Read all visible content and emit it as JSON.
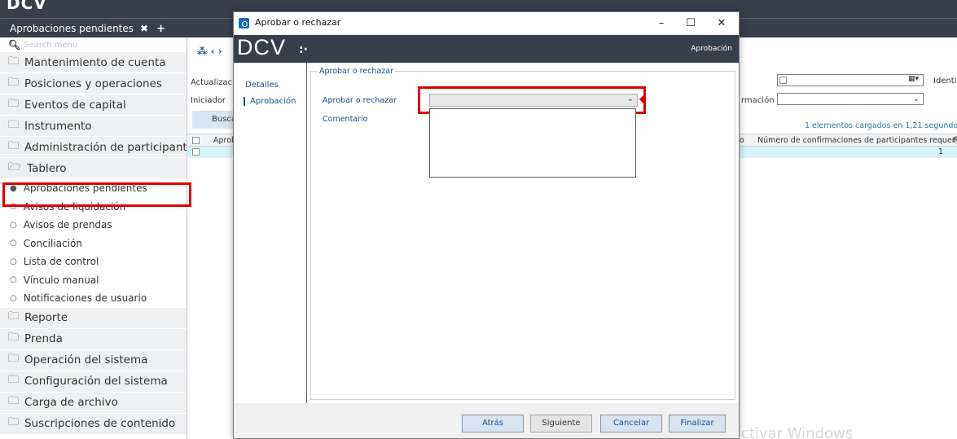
{
  "brand": {
    "logo_cut": "DCV"
  },
  "tabbar": {
    "active_tab": "Aprobaciones pendientes",
    "close_glyph": "✖",
    "add_glyph": "+"
  },
  "sidebar": {
    "search_placeholder": "Search menu",
    "groups_top": [
      "Mantenimiento de cuenta",
      "Posiciones y operaciones",
      "Eventos de capital",
      "Instrumento",
      "Administración de participantes",
      "Tablero"
    ],
    "tablero_items": [
      "Aprobaciones pendientes",
      "Avisos de liquidación",
      "Avisos de prendas",
      "Conciliación",
      "Lista de control",
      "Vínculo manual",
      "Notificaciones de usuario"
    ],
    "groups_bottom": [
      "Reporte",
      "Prenda",
      "Operación del sistema",
      "Configuración del sistema",
      "Carga de archivo",
      "Suscripciones de contenido"
    ]
  },
  "background": {
    "toolbar_glyphs": "⁂ ‹ ›",
    "label_actualizacion": "Actualizació",
    "label_iniciador": "Iniciador",
    "label_identif": "Identif",
    "label_rmacion": "rmación",
    "button_buscar": "Buscar",
    "loaded_text": "1 elementos cargados en 1,21 segundo",
    "col_aprob": "Aprob",
    "col_o": "o",
    "col_confirmaciones": "Número de confirmaciones de participantes requeridas",
    "col_f": "F",
    "row_value": "1",
    "watermark": "ctivar Windows"
  },
  "dialog": {
    "title": "Aprobar o rechazar",
    "window_buttons": {
      "minimize": "–",
      "maximize": "☐",
      "close": "✕"
    },
    "banner_brand": "DCV",
    "banner_step": "Aprobación",
    "nav": [
      "Detalles",
      "Aprobación"
    ],
    "section_legend": "Aprobar o rechazar",
    "field_label_decision": "Aprobar o rechazar",
    "field_value_decision": "",
    "field_label_comment": "Comentario",
    "field_value_comment": "",
    "buttons": {
      "back": "Atrás",
      "next": "Siguiente",
      "cancel": "Cancelar",
      "finish": "Finalizar"
    }
  },
  "colors": {
    "header_dark": "#373f4b",
    "highlight_red": "#e00000",
    "link_blue": "#1f4f8a",
    "grid_row_cyan": "#d9f4f8"
  }
}
